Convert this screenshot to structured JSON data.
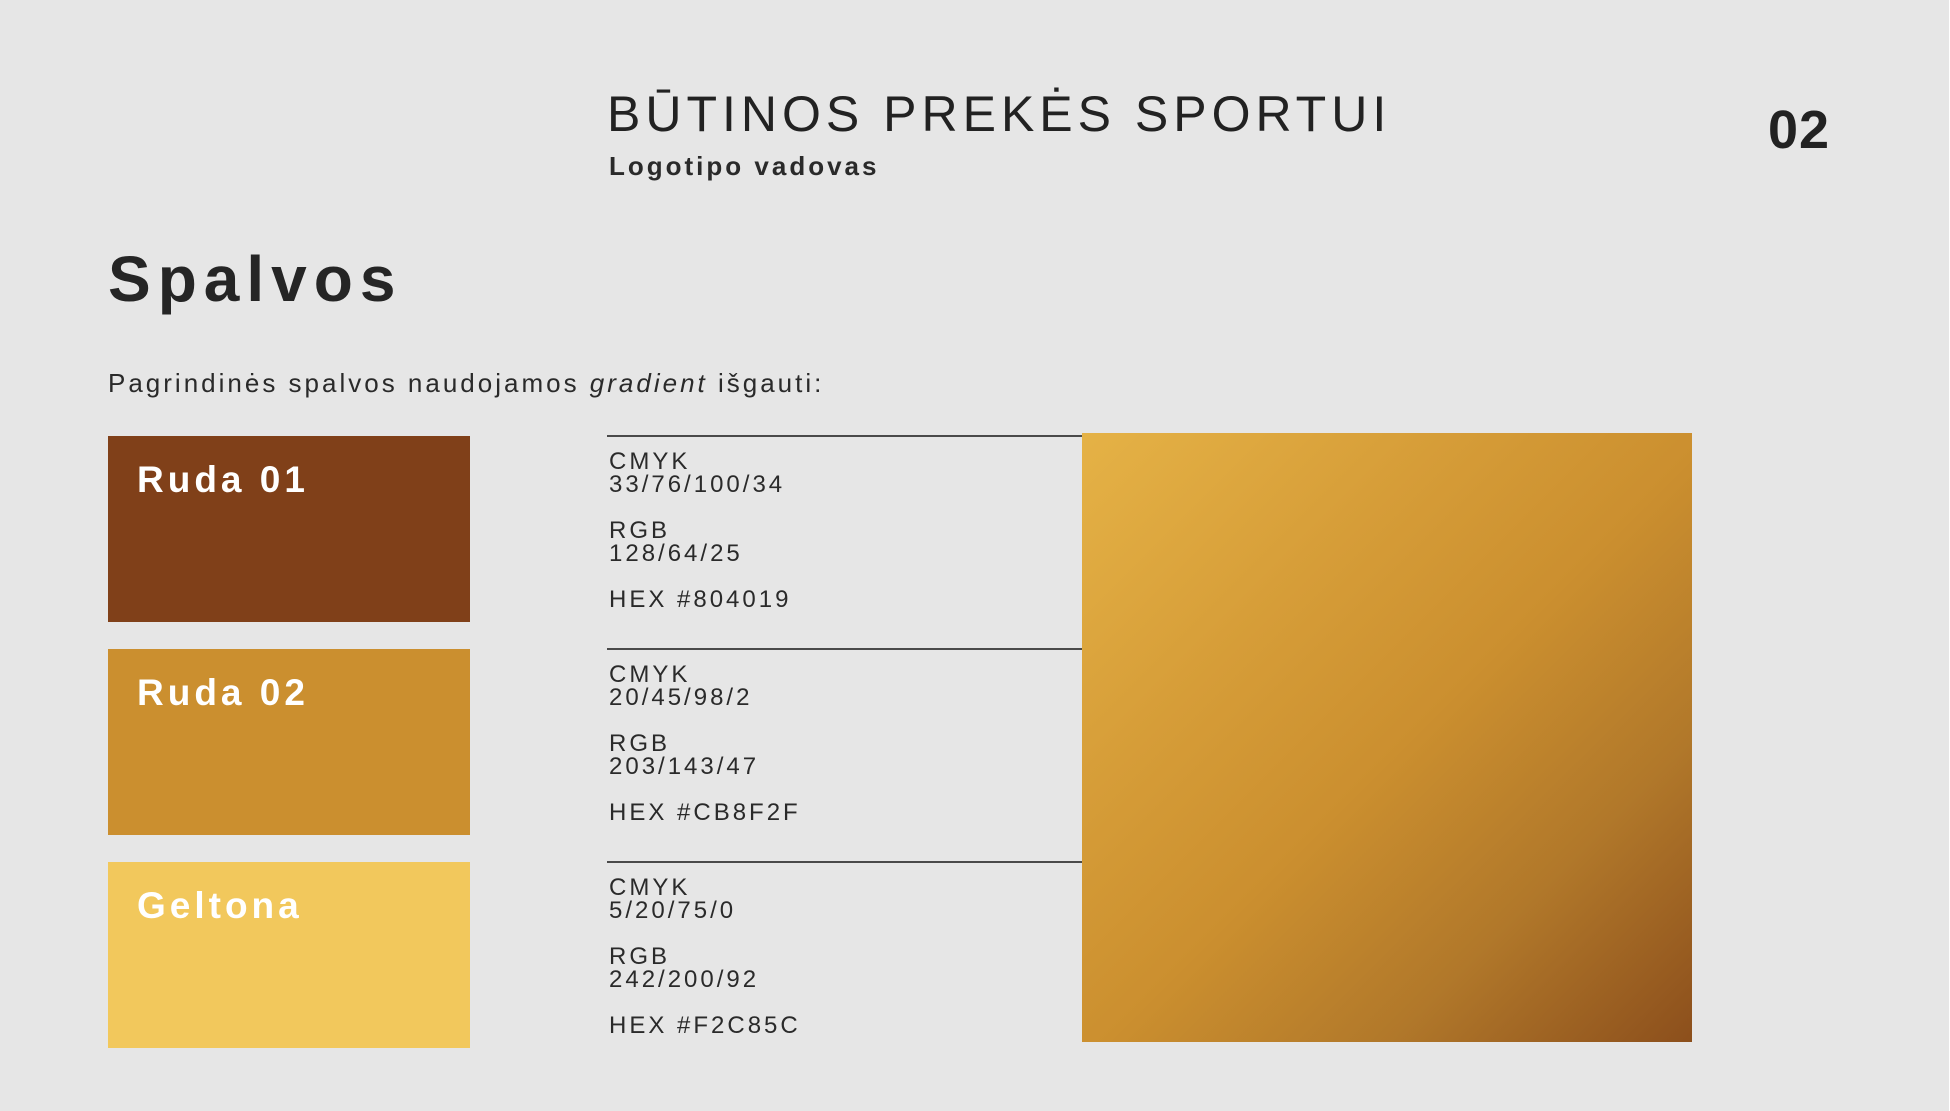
{
  "header": {
    "brand_title": "BŪTINOS PREKĖS SPORTUI",
    "subtitle": "Logotipo vadovas",
    "page_number": "02"
  },
  "section": {
    "title": "Spalvos",
    "intro_prefix": "Pagrindinės spalvos naudojamos ",
    "intro_emphasis": "gradient",
    "intro_suffix": " išgauti:"
  },
  "colors": [
    {
      "name": "Ruda 01",
      "hex_color": "#804019",
      "cmyk_label": "CMYK",
      "cmyk_value": "33/76/100/34",
      "rgb_label": "RGB",
      "rgb_value": "128/64/25",
      "hex_text": "HEX #804019"
    },
    {
      "name": "Ruda 02",
      "hex_color": "#CB8F2F",
      "cmyk_label": "CMYK",
      "cmyk_value": "20/45/98/2",
      "rgb_label": "RGB",
      "rgb_value": "203/143/47",
      "hex_text": "HEX #CB8F2F"
    },
    {
      "name": "Geltona",
      "hex_color": "#F2C85C",
      "cmyk_label": "CMYK",
      "cmyk_value": "5/20/75/0",
      "rgb_label": "RGB",
      "rgb_value": "242/200/92",
      "hex_text": "HEX #F2C85C"
    }
  ],
  "gradient": {
    "colors": [
      "#F2C85C",
      "#CB8F2F",
      "#804019"
    ]
  },
  "theme": {
    "background": "#E6E6E6",
    "text": "#222222"
  }
}
